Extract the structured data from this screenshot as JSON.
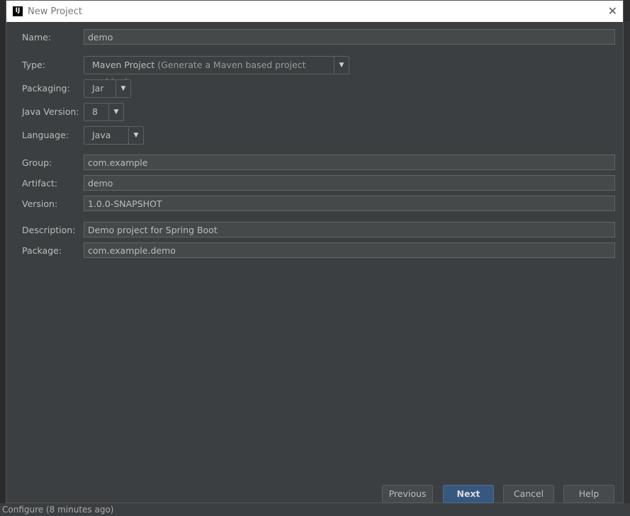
{
  "background": {
    "status_text": "Configure (8 minutes ago)"
  },
  "dialog": {
    "title": "New Project",
    "logo": "IJ"
  },
  "form": {
    "name": {
      "label": "Name:",
      "value": "demo"
    },
    "type": {
      "label": "Type:",
      "value": "Maven Project",
      "hint": "(Generate a Maven based project archive)"
    },
    "packaging": {
      "label": "Packaging:",
      "value": "Jar"
    },
    "java_version": {
      "label": "Java Version:",
      "value": "8"
    },
    "language": {
      "label": "Language:",
      "value": "Java"
    },
    "group": {
      "label": "Group:",
      "value": "com.example"
    },
    "artifact": {
      "label": "Artifact:",
      "value": "demo"
    },
    "version": {
      "label": "Version:",
      "value": "1.0.0-SNAPSHOT"
    },
    "description": {
      "label": "Description:",
      "value": "Demo project for Spring Boot"
    },
    "package": {
      "label": "Package:",
      "value": "com.example.demo"
    }
  },
  "buttons": {
    "previous": "Previous",
    "next": "Next",
    "cancel": "Cancel",
    "help": "Help"
  },
  "colors": {
    "accent": "#365880",
    "panel": "#3c3f41"
  }
}
